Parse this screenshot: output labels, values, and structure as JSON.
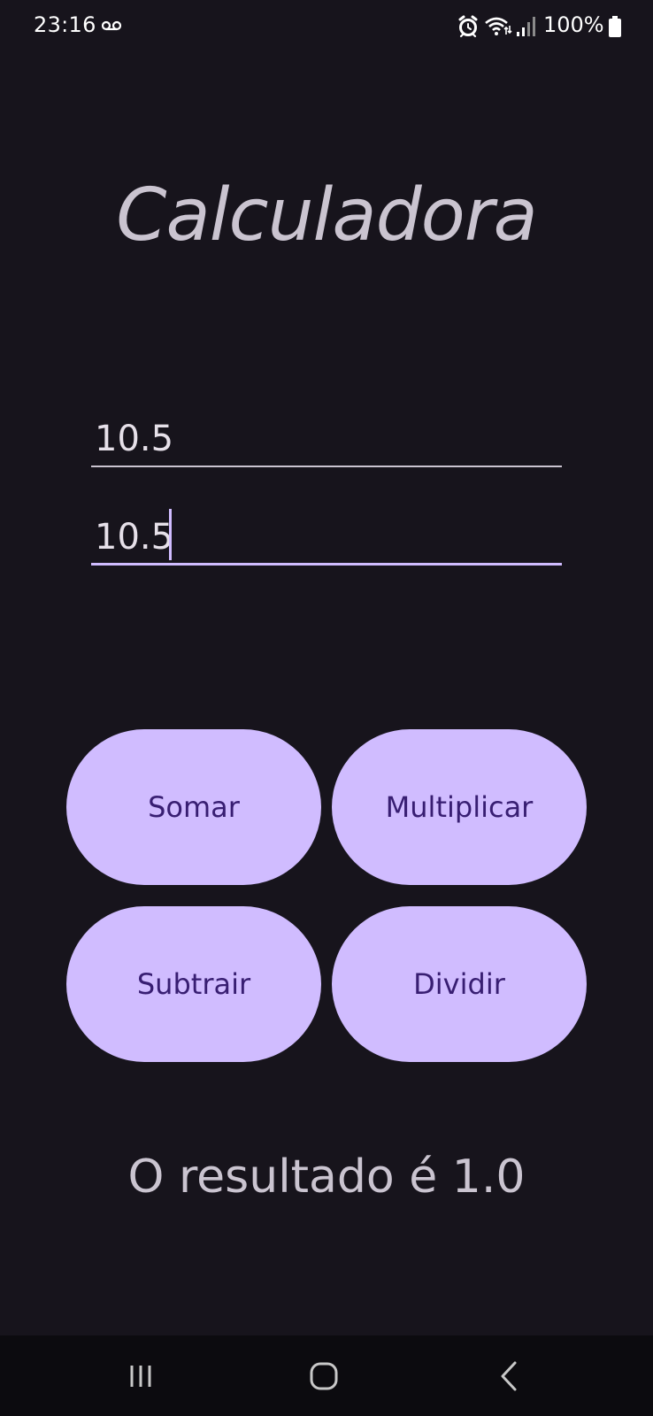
{
  "status_bar": {
    "time": "23:16",
    "battery": "100%",
    "icons": [
      "voicemail-icon",
      "alarm-icon",
      "wifi-icon",
      "signal-icon",
      "battery-icon"
    ]
  },
  "app": {
    "title": "Calculadora"
  },
  "inputs": {
    "first_value": "10.5",
    "second_value": "10.5"
  },
  "buttons": {
    "add": "Somar",
    "multiply": "Multiplicar",
    "subtract": "Subtrair",
    "divide": "Dividir"
  },
  "result": {
    "text": "O resultado é 1.0"
  },
  "navigation": {
    "icons": [
      "recents-icon",
      "home-icon",
      "back-icon"
    ]
  },
  "colors": {
    "background": "#17141c",
    "button_fill": "#d0bcff",
    "button_text": "#381e72",
    "text_primary": "#cac4d0",
    "nav_background": "#0c0b0f"
  }
}
